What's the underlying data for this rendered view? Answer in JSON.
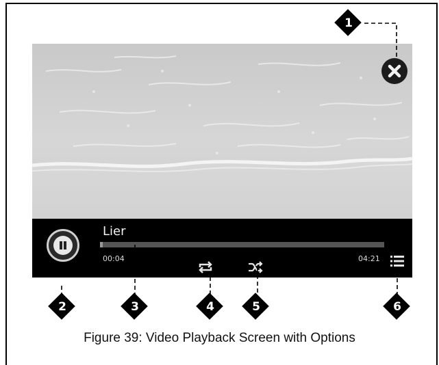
{
  "document": {
    "caption": "Figure 39: Video Playback Screen with Options"
  },
  "player": {
    "track_title": "Lier",
    "elapsed": "00:04",
    "duration": "04:21",
    "progress_fraction": 0.01,
    "state": "playing"
  },
  "callouts": [
    "1",
    "2",
    "3",
    "4",
    "5",
    "6"
  ],
  "icons": {
    "close": "close-icon",
    "pause": "pause-icon",
    "repeat": "repeat-icon",
    "shuffle": "shuffle-icon",
    "list": "list-icon"
  },
  "colors": {
    "control_bar": "#000000",
    "progress_track": "#555555",
    "text": "#f0f0f0"
  }
}
